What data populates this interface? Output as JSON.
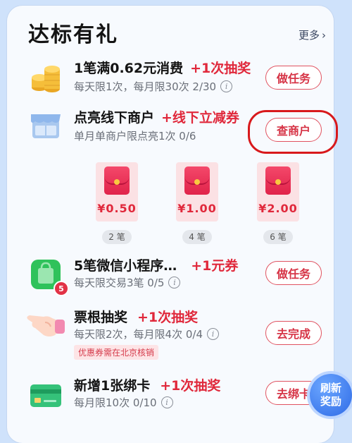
{
  "section": {
    "title": "达标有礼",
    "more_label": "更多"
  },
  "tasks": [
    {
      "title": "1笔满0.62元消费",
      "reward": "+1次抽奖",
      "sub": "每天限1次，每月限30次 2/30",
      "button": "做任务"
    },
    {
      "title": "点亮线下商户",
      "reward": "+线下立减券",
      "sub": "单月单商户限点亮1次 0/6",
      "button": "查商户"
    },
    {
      "title": "5笔微信小程序…",
      "reward": "+1元券",
      "sub": "每天限交易3笔 0/5",
      "button": "做任务",
      "badge": "5"
    },
    {
      "title": "票根抽奖",
      "reward": "+1次抽奖",
      "sub": "每天限2次，每月限4次 0/4",
      "button": "去完成",
      "notice": "优惠券需在北京核销"
    },
    {
      "title": "新增1张绑卡",
      "reward": "+1次抽奖",
      "sub": "每月限10次 0/10",
      "button": "去绑卡"
    }
  ],
  "tiers": [
    {
      "amount": "¥0.50",
      "count": "2 笔"
    },
    {
      "amount": "¥1.00",
      "count": "4 笔"
    },
    {
      "amount": "¥2.00",
      "count": "6 笔"
    }
  ],
  "float_button": {
    "line1": "刷新",
    "line2": "奖励"
  },
  "colors": {
    "accent_red": "#e0283b",
    "page_bg": "#cfe2fb",
    "highlight": "#d8191c"
  }
}
